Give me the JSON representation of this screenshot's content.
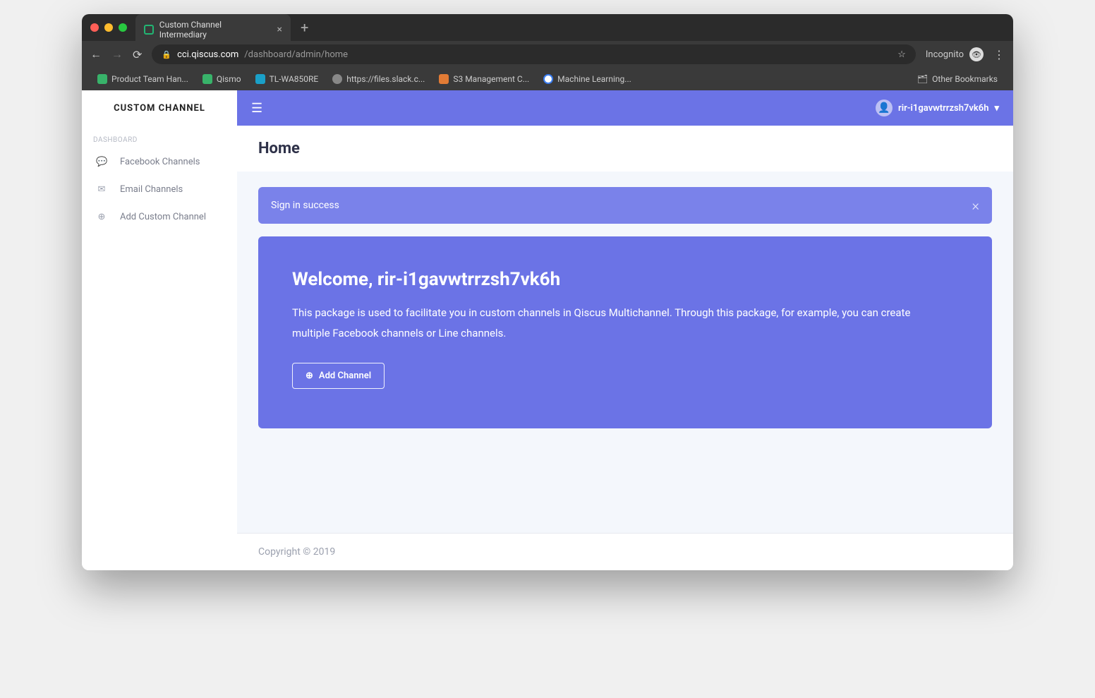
{
  "browser": {
    "tab_title": "Custom Channel Intermediary",
    "url_host": "cci.qiscus.com",
    "url_path": "/dashboard/admin/home",
    "incognito_label": "Incognito",
    "other_bookmarks": "Other Bookmarks",
    "bookmarks": [
      {
        "label": "Product Team Han...",
        "color": "#38b36a"
      },
      {
        "label": "Qismo",
        "color": "#38b36a"
      },
      {
        "label": "TL-WA850RE",
        "color": "#1aa0c8"
      },
      {
        "label": "https://files.slack.c...",
        "color": "#888"
      },
      {
        "label": "S3 Management C...",
        "color": "#e27b35"
      },
      {
        "label": "Machine Learning...",
        "color": "#3a7df0"
      }
    ]
  },
  "sidebar": {
    "brand": "CUSTOM CHANNEL",
    "section": "DASHBOARD",
    "items": [
      {
        "icon": "fb",
        "label": "Facebook Channels"
      },
      {
        "icon": "mail",
        "label": "Email Channels"
      },
      {
        "icon": "plus",
        "label": "Add Custom Channel"
      }
    ]
  },
  "header": {
    "username": "rir-i1gavwtrrzsh7vk6h"
  },
  "page": {
    "title": "Home",
    "alert": "Sign in success",
    "welcome": "Welcome, rir-i1gavwtrrzsh7vk6h",
    "description": "This package is used to facilitate you in custom channels in Qiscus Multichannel. Through this package, for example, you can create multiple Facebook channels or Line channels.",
    "add_button": "Add Channel"
  },
  "footer": {
    "text": "Copyright © 2019"
  }
}
